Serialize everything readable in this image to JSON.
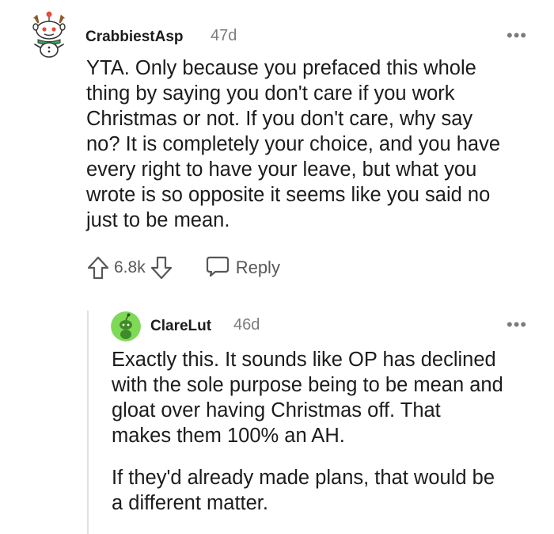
{
  "comment": {
    "username": "CrabbiestAsp",
    "age": "47d",
    "avatar_icon": "snoo-reindeer-avatar-icon",
    "more_icon": "more-options-icon",
    "more_label": "•••",
    "body_lines": [
      "YTA. Only because you prefaced this whole",
      "thing by saying you don't care if you work",
      "Christmas or not. If you don't care, why say",
      "no? It is completely your choice, and you have",
      "every right to have your leave, but what you",
      "wrote is so opposite it seems like you said no",
      "just to be mean."
    ],
    "score": "6.8k",
    "upvote_icon": "upvote-arrow-icon",
    "downvote_icon": "downvote-arrow-icon",
    "reply_icon": "reply-bubble-icon",
    "reply_label": "Reply"
  },
  "reply": {
    "username": "ClareLut",
    "age": "46d",
    "avatar_icon": "snoo-green-avatar-icon",
    "avatar_color": "#7ed957",
    "more_icon": "more-options-icon",
    "more_label": "•••",
    "paragraphs": [
      [
        "Exactly this. It sounds like OP has declined",
        "with the sole purpose being to be mean and",
        "gloat over having Christmas off. That",
        "makes them 100% an AH."
      ],
      [
        "If they'd already made plans, that would be",
        "a different matter."
      ]
    ]
  },
  "colors": {
    "text": "#1c1c1c",
    "meta": "#7c7c7c",
    "action": "#575757",
    "thread_line": "#e0e0e0"
  }
}
